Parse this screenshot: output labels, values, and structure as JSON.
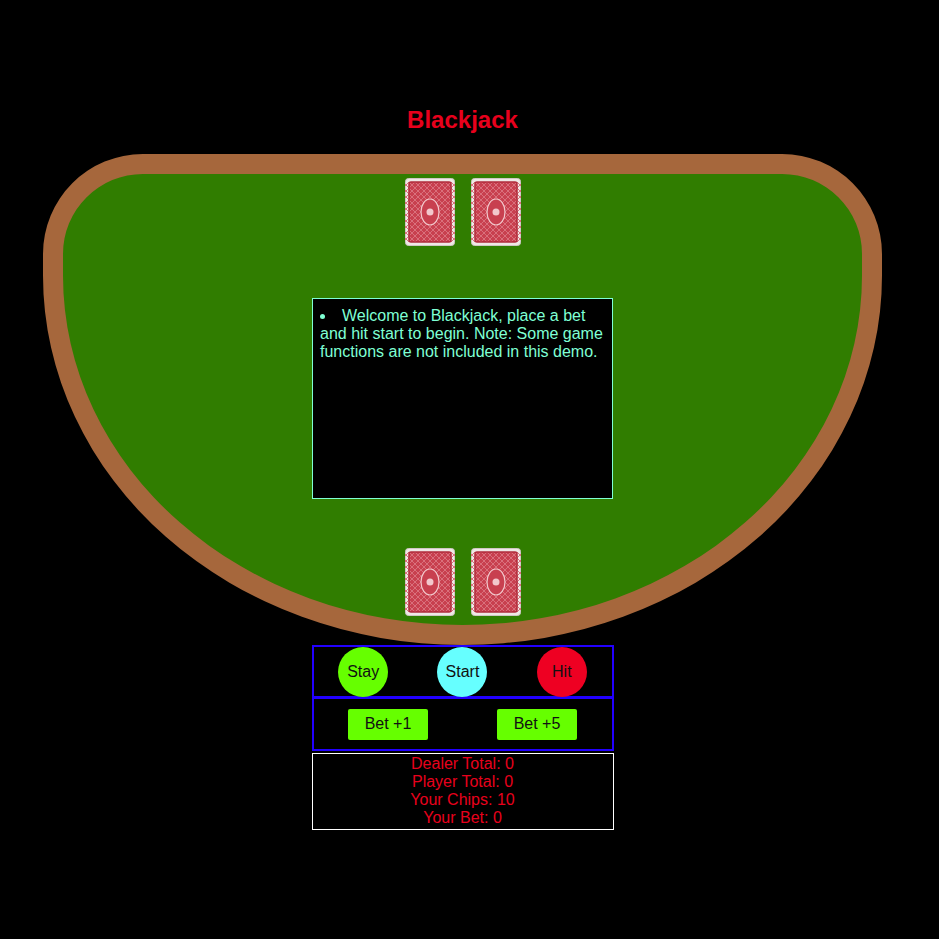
{
  "title": "Blackjack",
  "dealer_cards": [
    {
      "face_down": true
    },
    {
      "face_down": true
    }
  ],
  "messages": [
    "Welcome to Blackjack, place a bet and hit start to begin. Note: Some game functions are not included in this demo."
  ],
  "player_cards": [
    {
      "face_down": true
    },
    {
      "face_down": true
    }
  ],
  "actions": [
    {
      "label": "Stay",
      "color": "#66ff00"
    },
    {
      "label": "Start",
      "color": "#66ffff"
    },
    {
      "label": "Hit",
      "color": "#ee0022"
    }
  ],
  "bets": [
    "Bet +1",
    "Bet +5"
  ],
  "stats": [
    "Dealer Total: 0",
    "Player Total: 0",
    "Your Chips: 10",
    "Your Bet: 0"
  ]
}
